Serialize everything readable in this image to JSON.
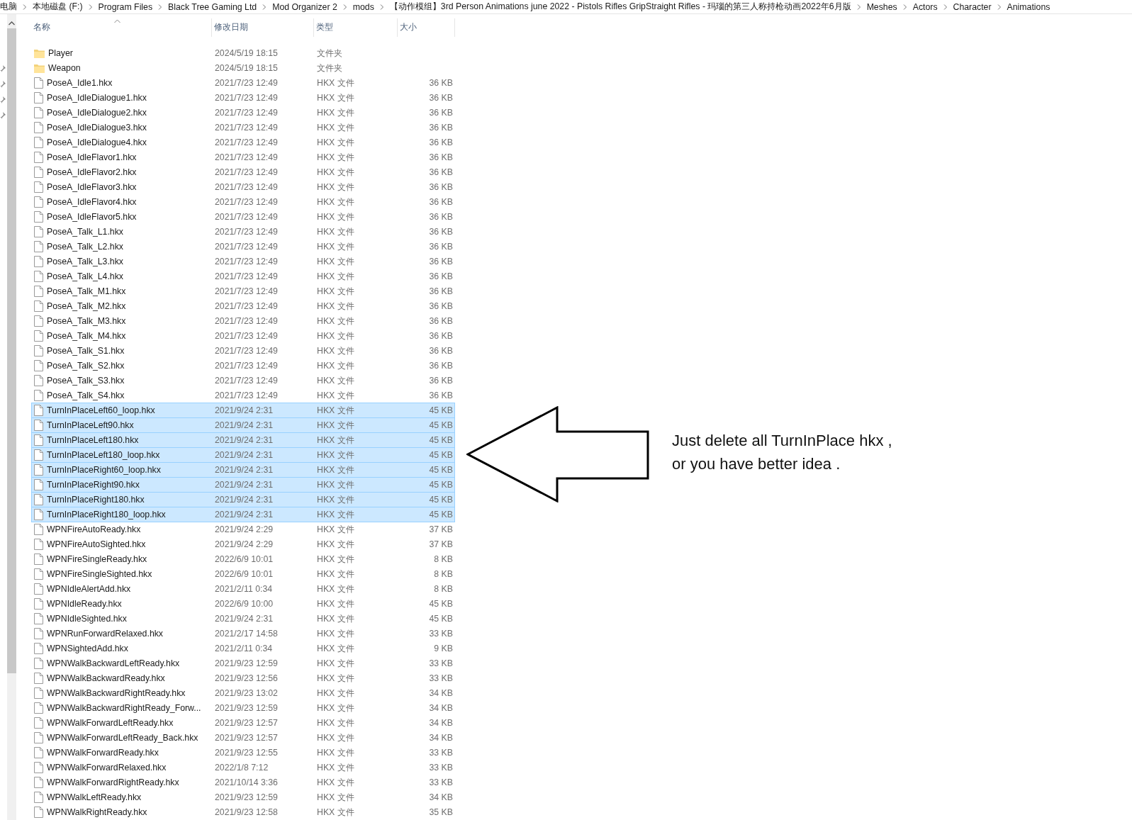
{
  "breadcrumb": [
    "电脑",
    "本地磁盘 (F:)",
    "Program Files",
    "Black Tree Gaming Ltd",
    "Mod Organizer 2",
    "mods",
    "【动作模组】3rd Person Animations june 2022 - Pistols Rifles GripStraight Rifles - 玛瑙的第三人称持枪动画2022年6月版",
    "Meshes",
    "Actors",
    "Character",
    "Animations"
  ],
  "columns": [
    {
      "label": "名称",
      "sorted": true
    },
    {
      "label": "修改日期",
      "sorted": false
    },
    {
      "label": "类型",
      "sorted": false
    },
    {
      "label": "大小",
      "sorted": false
    }
  ],
  "rows": [
    {
      "kind": "folder",
      "name": "Player",
      "date": "2024/5/19 18:15",
      "type": "文件夹",
      "selected": false
    },
    {
      "kind": "folder",
      "name": "Weapon",
      "date": "2024/5/19 18:15",
      "type": "文件夹",
      "selected": false
    },
    {
      "kind": "file",
      "name": "PoseA_Idle1.hkx",
      "date": "2021/7/23 12:49",
      "type": "HKX 文件",
      "size": "36 KB",
      "selected": false
    },
    {
      "kind": "file",
      "name": "PoseA_IdleDialogue1.hkx",
      "date": "2021/7/23 12:49",
      "type": "HKX 文件",
      "size": "36 KB",
      "selected": false
    },
    {
      "kind": "file",
      "name": "PoseA_IdleDialogue2.hkx",
      "date": "2021/7/23 12:49",
      "type": "HKX 文件",
      "size": "36 KB",
      "selected": false
    },
    {
      "kind": "file",
      "name": "PoseA_IdleDialogue3.hkx",
      "date": "2021/7/23 12:49",
      "type": "HKX 文件",
      "size": "36 KB",
      "selected": false
    },
    {
      "kind": "file",
      "name": "PoseA_IdleDialogue4.hkx",
      "date": "2021/7/23 12:49",
      "type": "HKX 文件",
      "size": "36 KB",
      "selected": false
    },
    {
      "kind": "file",
      "name": "PoseA_IdleFlavor1.hkx",
      "date": "2021/7/23 12:49",
      "type": "HKX 文件",
      "size": "36 KB",
      "selected": false
    },
    {
      "kind": "file",
      "name": "PoseA_IdleFlavor2.hkx",
      "date": "2021/7/23 12:49",
      "type": "HKX 文件",
      "size": "36 KB",
      "selected": false
    },
    {
      "kind": "file",
      "name": "PoseA_IdleFlavor3.hkx",
      "date": "2021/7/23 12:49",
      "type": "HKX 文件",
      "size": "36 KB",
      "selected": false
    },
    {
      "kind": "file",
      "name": "PoseA_IdleFlavor4.hkx",
      "date": "2021/7/23 12:49",
      "type": "HKX 文件",
      "size": "36 KB",
      "selected": false
    },
    {
      "kind": "file",
      "name": "PoseA_IdleFlavor5.hkx",
      "date": "2021/7/23 12:49",
      "type": "HKX 文件",
      "size": "36 KB",
      "selected": false
    },
    {
      "kind": "file",
      "name": "PoseA_Talk_L1.hkx",
      "date": "2021/7/23 12:49",
      "type": "HKX 文件",
      "size": "36 KB",
      "selected": false
    },
    {
      "kind": "file",
      "name": "PoseA_Talk_L2.hkx",
      "date": "2021/7/23 12:49",
      "type": "HKX 文件",
      "size": "36 KB",
      "selected": false
    },
    {
      "kind": "file",
      "name": "PoseA_Talk_L3.hkx",
      "date": "2021/7/23 12:49",
      "type": "HKX 文件",
      "size": "36 KB",
      "selected": false
    },
    {
      "kind": "file",
      "name": "PoseA_Talk_L4.hkx",
      "date": "2021/7/23 12:49",
      "type": "HKX 文件",
      "size": "36 KB",
      "selected": false
    },
    {
      "kind": "file",
      "name": "PoseA_Talk_M1.hkx",
      "date": "2021/7/23 12:49",
      "type": "HKX 文件",
      "size": "36 KB",
      "selected": false
    },
    {
      "kind": "file",
      "name": "PoseA_Talk_M2.hkx",
      "date": "2021/7/23 12:49",
      "type": "HKX 文件",
      "size": "36 KB",
      "selected": false
    },
    {
      "kind": "file",
      "name": "PoseA_Talk_M3.hkx",
      "date": "2021/7/23 12:49",
      "type": "HKX 文件",
      "size": "36 KB",
      "selected": false
    },
    {
      "kind": "file",
      "name": "PoseA_Talk_M4.hkx",
      "date": "2021/7/23 12:49",
      "type": "HKX 文件",
      "size": "36 KB",
      "selected": false
    },
    {
      "kind": "file",
      "name": "PoseA_Talk_S1.hkx",
      "date": "2021/7/23 12:49",
      "type": "HKX 文件",
      "size": "36 KB",
      "selected": false
    },
    {
      "kind": "file",
      "name": "PoseA_Talk_S2.hkx",
      "date": "2021/7/23 12:49",
      "type": "HKX 文件",
      "size": "36 KB",
      "selected": false
    },
    {
      "kind": "file",
      "name": "PoseA_Talk_S3.hkx",
      "date": "2021/7/23 12:49",
      "type": "HKX 文件",
      "size": "36 KB",
      "selected": false
    },
    {
      "kind": "file",
      "name": "PoseA_Talk_S4.hkx",
      "date": "2021/7/23 12:49",
      "type": "HKX 文件",
      "size": "36 KB",
      "selected": false
    },
    {
      "kind": "file",
      "name": "TurnInPlaceLeft60_loop.hkx",
      "date": "2021/9/24 2:31",
      "type": "HKX 文件",
      "size": "45 KB",
      "selected": true
    },
    {
      "kind": "file",
      "name": "TurnInPlaceLeft90.hkx",
      "date": "2021/9/24 2:31",
      "type": "HKX 文件",
      "size": "45 KB",
      "selected": true
    },
    {
      "kind": "file",
      "name": "TurnInPlaceLeft180.hkx",
      "date": "2021/9/24 2:31",
      "type": "HKX 文件",
      "size": "45 KB",
      "selected": true
    },
    {
      "kind": "file",
      "name": "TurnInPlaceLeft180_loop.hkx",
      "date": "2021/9/24 2:31",
      "type": "HKX 文件",
      "size": "45 KB",
      "selected": true
    },
    {
      "kind": "file",
      "name": "TurnInPlaceRight60_loop.hkx",
      "date": "2021/9/24 2:31",
      "type": "HKX 文件",
      "size": "45 KB",
      "selected": true
    },
    {
      "kind": "file",
      "name": "TurnInPlaceRight90.hkx",
      "date": "2021/9/24 2:31",
      "type": "HKX 文件",
      "size": "45 KB",
      "selected": true
    },
    {
      "kind": "file",
      "name": "TurnInPlaceRight180.hkx",
      "date": "2021/9/24 2:31",
      "type": "HKX 文件",
      "size": "45 KB",
      "selected": true
    },
    {
      "kind": "file",
      "name": "TurnInPlaceRight180_loop.hkx",
      "date": "2021/9/24 2:31",
      "type": "HKX 文件",
      "size": "45 KB",
      "selected": true
    },
    {
      "kind": "file",
      "name": "WPNFireAutoReady.hkx",
      "date": "2021/9/24 2:29",
      "type": "HKX 文件",
      "size": "37 KB",
      "selected": false
    },
    {
      "kind": "file",
      "name": "WPNFireAutoSighted.hkx",
      "date": "2021/9/24 2:29",
      "type": "HKX 文件",
      "size": "37 KB",
      "selected": false
    },
    {
      "kind": "file",
      "name": "WPNFireSingleReady.hkx",
      "date": "2022/6/9 10:01",
      "type": "HKX 文件",
      "size": "8 KB",
      "selected": false
    },
    {
      "kind": "file",
      "name": "WPNFireSingleSighted.hkx",
      "date": "2022/6/9 10:01",
      "type": "HKX 文件",
      "size": "8 KB",
      "selected": false
    },
    {
      "kind": "file",
      "name": "WPNIdleAlertAdd.hkx",
      "date": "2021/2/11 0:34",
      "type": "HKX 文件",
      "size": "8 KB",
      "selected": false
    },
    {
      "kind": "file",
      "name": "WPNIdleReady.hkx",
      "date": "2022/6/9 10:00",
      "type": "HKX 文件",
      "size": "45 KB",
      "selected": false
    },
    {
      "kind": "file",
      "name": "WPNIdleSighted.hkx",
      "date": "2021/9/24 2:31",
      "type": "HKX 文件",
      "size": "45 KB",
      "selected": false
    },
    {
      "kind": "file",
      "name": "WPNRunForwardRelaxed.hkx",
      "date": "2021/2/17 14:58",
      "type": "HKX 文件",
      "size": "33 KB",
      "selected": false
    },
    {
      "kind": "file",
      "name": "WPNSightedAdd.hkx",
      "date": "2021/2/11 0:34",
      "type": "HKX 文件",
      "size": "9 KB",
      "selected": false
    },
    {
      "kind": "file",
      "name": "WPNWalkBackwardLeftReady.hkx",
      "date": "2021/9/23 12:59",
      "type": "HKX 文件",
      "size": "33 KB",
      "selected": false
    },
    {
      "kind": "file",
      "name": "WPNWalkBackwardReady.hkx",
      "date": "2021/9/23 12:56",
      "type": "HKX 文件",
      "size": "33 KB",
      "selected": false
    },
    {
      "kind": "file",
      "name": "WPNWalkBackwardRightReady.hkx",
      "date": "2021/9/23 13:02",
      "type": "HKX 文件",
      "size": "34 KB",
      "selected": false
    },
    {
      "kind": "file",
      "name": "WPNWalkBackwardRightReady_Forw...",
      "date": "2021/9/23 12:59",
      "type": "HKX 文件",
      "size": "34 KB",
      "selected": false
    },
    {
      "kind": "file",
      "name": "WPNWalkForwardLeftReady.hkx",
      "date": "2021/9/23 12:57",
      "type": "HKX 文件",
      "size": "34 KB",
      "selected": false
    },
    {
      "kind": "file",
      "name": "WPNWalkForwardLeftReady_Back.hkx",
      "date": "2021/9/23 12:57",
      "type": "HKX 文件",
      "size": "34 KB",
      "selected": false
    },
    {
      "kind": "file",
      "name": "WPNWalkForwardReady.hkx",
      "date": "2021/9/23 12:55",
      "type": "HKX 文件",
      "size": "33 KB",
      "selected": false
    },
    {
      "kind": "file",
      "name": "WPNWalkForwardRelaxed.hkx",
      "date": "2022/1/8 7:12",
      "type": "HKX 文件",
      "size": "33 KB",
      "selected": false
    },
    {
      "kind": "file",
      "name": "WPNWalkForwardRightReady.hkx",
      "date": "2021/10/14 3:36",
      "type": "HKX 文件",
      "size": "33 KB",
      "selected": false
    },
    {
      "kind": "file",
      "name": "WPNWalkLeftReady.hkx",
      "date": "2021/9/23 12:59",
      "type": "HKX 文件",
      "size": "34 KB",
      "selected": false
    },
    {
      "kind": "file",
      "name": "WPNWalkRightReady.hkx",
      "date": "2021/9/23 12:58",
      "type": "HKX 文件",
      "size": "35 KB",
      "selected": false
    }
  ],
  "annotation": {
    "lines": [
      "Just delete all TurnInPlace hkx ,",
      "or you have better idea ."
    ]
  }
}
